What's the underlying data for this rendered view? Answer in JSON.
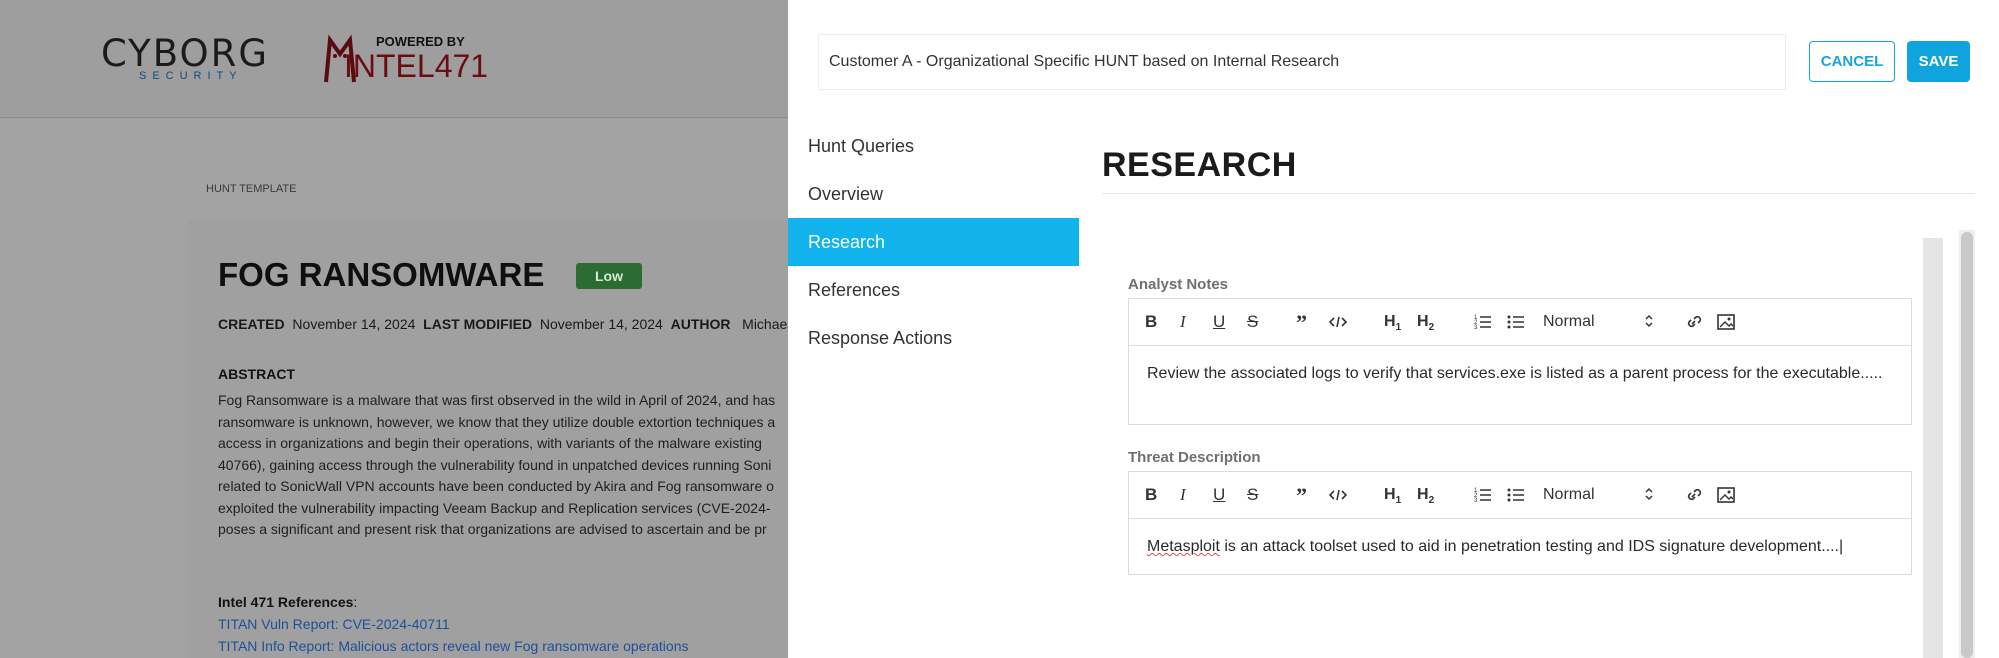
{
  "background_page": {
    "logo_cyborg": "CYBORG",
    "logo_cyborg_sub": "SECURITY",
    "logo_intel_powered": "POWERED BY",
    "logo_intel_brand": "INTEL471",
    "breadcrumb": "HUNT TEMPLATE",
    "title": "FOG RANSOMWARE",
    "severity_badge": "Low",
    "meta": {
      "created_label": "CREATED",
      "created_value": "November 14, 2024",
      "modified_label": "LAST MODIFIED",
      "modified_value": "November 14, 2024",
      "author_label": "AUTHOR",
      "author_value": "Michael M"
    },
    "abstract_heading": "ABSTRACT",
    "abstract_lines": [
      "Fog Ransomware is a malware that was first observed in the wild in April of 2024, and has",
      "ransomware is unknown, however, we know that they utilize double extortion techniques a",
      "access in organizations and begin their operations, with variants of the malware existing",
      "40766), gaining access through the vulnerability found in unpatched devices running Soni",
      "related to SonicWall VPN accounts have been conducted by Akira and Fog ransomware o",
      "exploited the vulnerability impacting Veeam Backup and Replication services (CVE-2024-",
      "poses a significant and present risk that organizations are advised to ascertain and be pr"
    ],
    "references_heading": "Intel 471 References",
    "references": [
      "TITAN Vuln Report: CVE-2024-40711",
      "TITAN Info Report: Malicious actors reveal new Fog ransomware operations"
    ]
  },
  "drawer": {
    "title_value": "Customer A - Organizational Specific HUNT based on Internal Research",
    "cancel_label": "CANCEL",
    "save_label": "SAVE",
    "nav": [
      {
        "label": "Hunt Queries",
        "active": false
      },
      {
        "label": "Overview",
        "active": false
      },
      {
        "label": "Research",
        "active": true
      },
      {
        "label": "References",
        "active": false
      },
      {
        "label": "Response Actions",
        "active": false
      }
    ],
    "section_title": "RESEARCH",
    "fields": [
      {
        "label": "Analyst Notes",
        "format": "Normal",
        "content": "Review the associated logs to verify that services.exe is listed as a parent process for the executable....."
      },
      {
        "label": "Threat Description",
        "format": "Normal",
        "content_prefix": "Metasploit",
        "content_rest": " is an attack toolset used to aid in penetration testing and IDS signature development...."
      }
    ],
    "toolbar_icons": [
      "bold-icon",
      "italic-icon",
      "underline-icon",
      "strikethrough-icon",
      "blockquote-icon",
      "code-icon",
      "h1-icon",
      "h2-icon",
      "ordered-list-icon",
      "bullet-list-icon",
      "link-icon",
      "image-icon"
    ],
    "accent_color": "#12b3ec"
  }
}
